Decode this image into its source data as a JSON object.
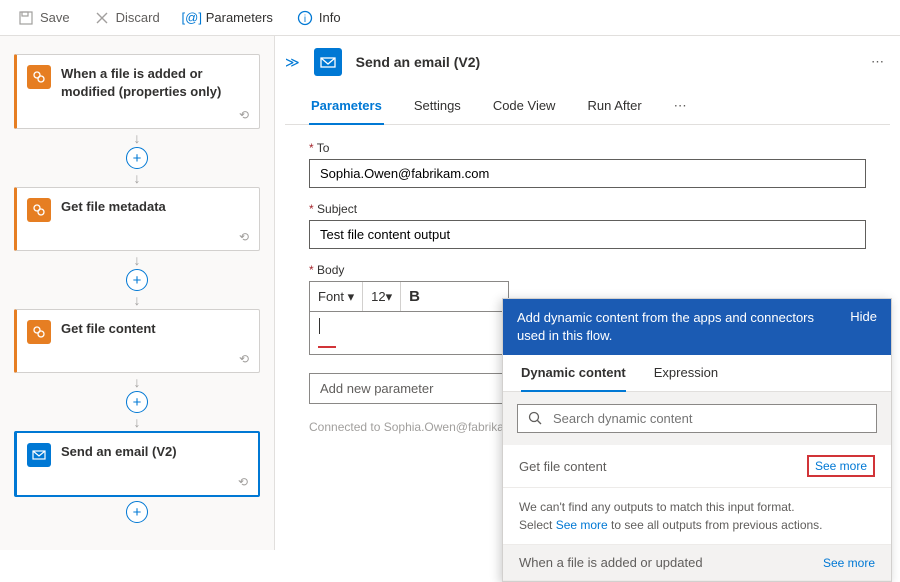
{
  "toolbar": {
    "save": "Save",
    "discard": "Discard",
    "parameters": "Parameters",
    "info": "Info"
  },
  "steps": {
    "trigger": "When a file is added or modified (properties only)",
    "metadata": "Get file metadata",
    "content": "Get file content",
    "email": "Send an email (V2)"
  },
  "action": {
    "title": "Send an email (V2)"
  },
  "tabs": {
    "parameters": "Parameters",
    "settings": "Settings",
    "codeview": "Code View",
    "runafter": "Run After"
  },
  "form": {
    "to_label": "To",
    "to_value": "Sophia.Owen@fabrikam.com",
    "subject_label": "Subject",
    "subject_value": "Test file content output",
    "body_label": "Body",
    "font_label": "Font",
    "font_size": "12",
    "add_param": "Add new parameter",
    "connected_prefix": "Connected to",
    "connected_value": "Sophia.Owen@fabrikam.com"
  },
  "flyout": {
    "banner": "Add dynamic content from the apps and connectors used in this flow.",
    "hide": "Hide",
    "tab_dynamic": "Dynamic content",
    "tab_expression": "Expression",
    "search_placeholder": "Search dynamic content",
    "section1": "Get file content",
    "see_more": "See more",
    "msg_line1": "We can't find any outputs to match this input format.",
    "msg_prefix": "Select ",
    "msg_link": "See more",
    "msg_suffix": " to see all outputs from previous actions.",
    "section2": "When a file is added or updated"
  }
}
